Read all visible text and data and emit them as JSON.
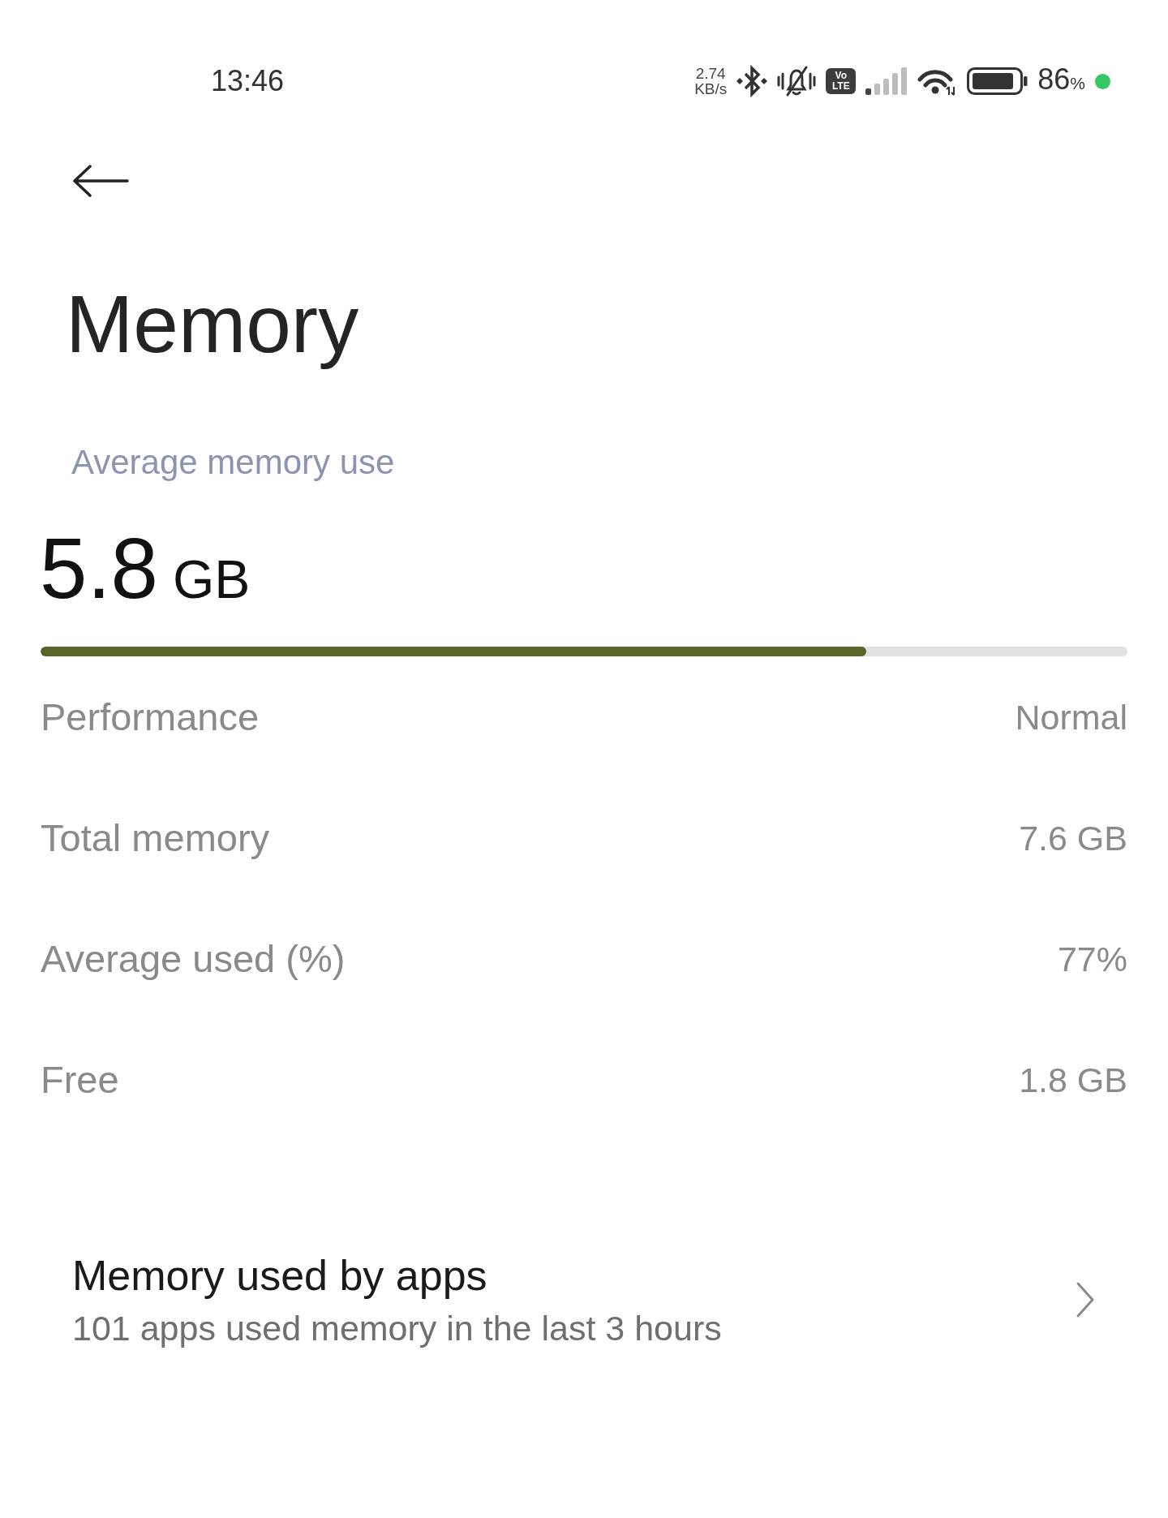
{
  "status_bar": {
    "time": "13:46",
    "network_speed": {
      "value": "2.74",
      "unit": "KB/s"
    },
    "volte_badge": "Vo LTE",
    "battery": {
      "value": "86",
      "unit": "%"
    }
  },
  "title": "Memory",
  "average_use": {
    "label": "Average memory use",
    "value": "5.8",
    "unit": "GB",
    "level": 0.76
  },
  "stats": [
    {
      "label": "Performance",
      "value": "Normal"
    },
    {
      "label": "Total memory",
      "value": "7.6 GB"
    },
    {
      "label": "Average used (%)",
      "value": "77%"
    },
    {
      "label": "Free",
      "value": "1.8 GB"
    }
  ],
  "apps_entry": {
    "title": "Memory used by apps",
    "subtitle": "101 apps used memory in the last 3 hours"
  }
}
